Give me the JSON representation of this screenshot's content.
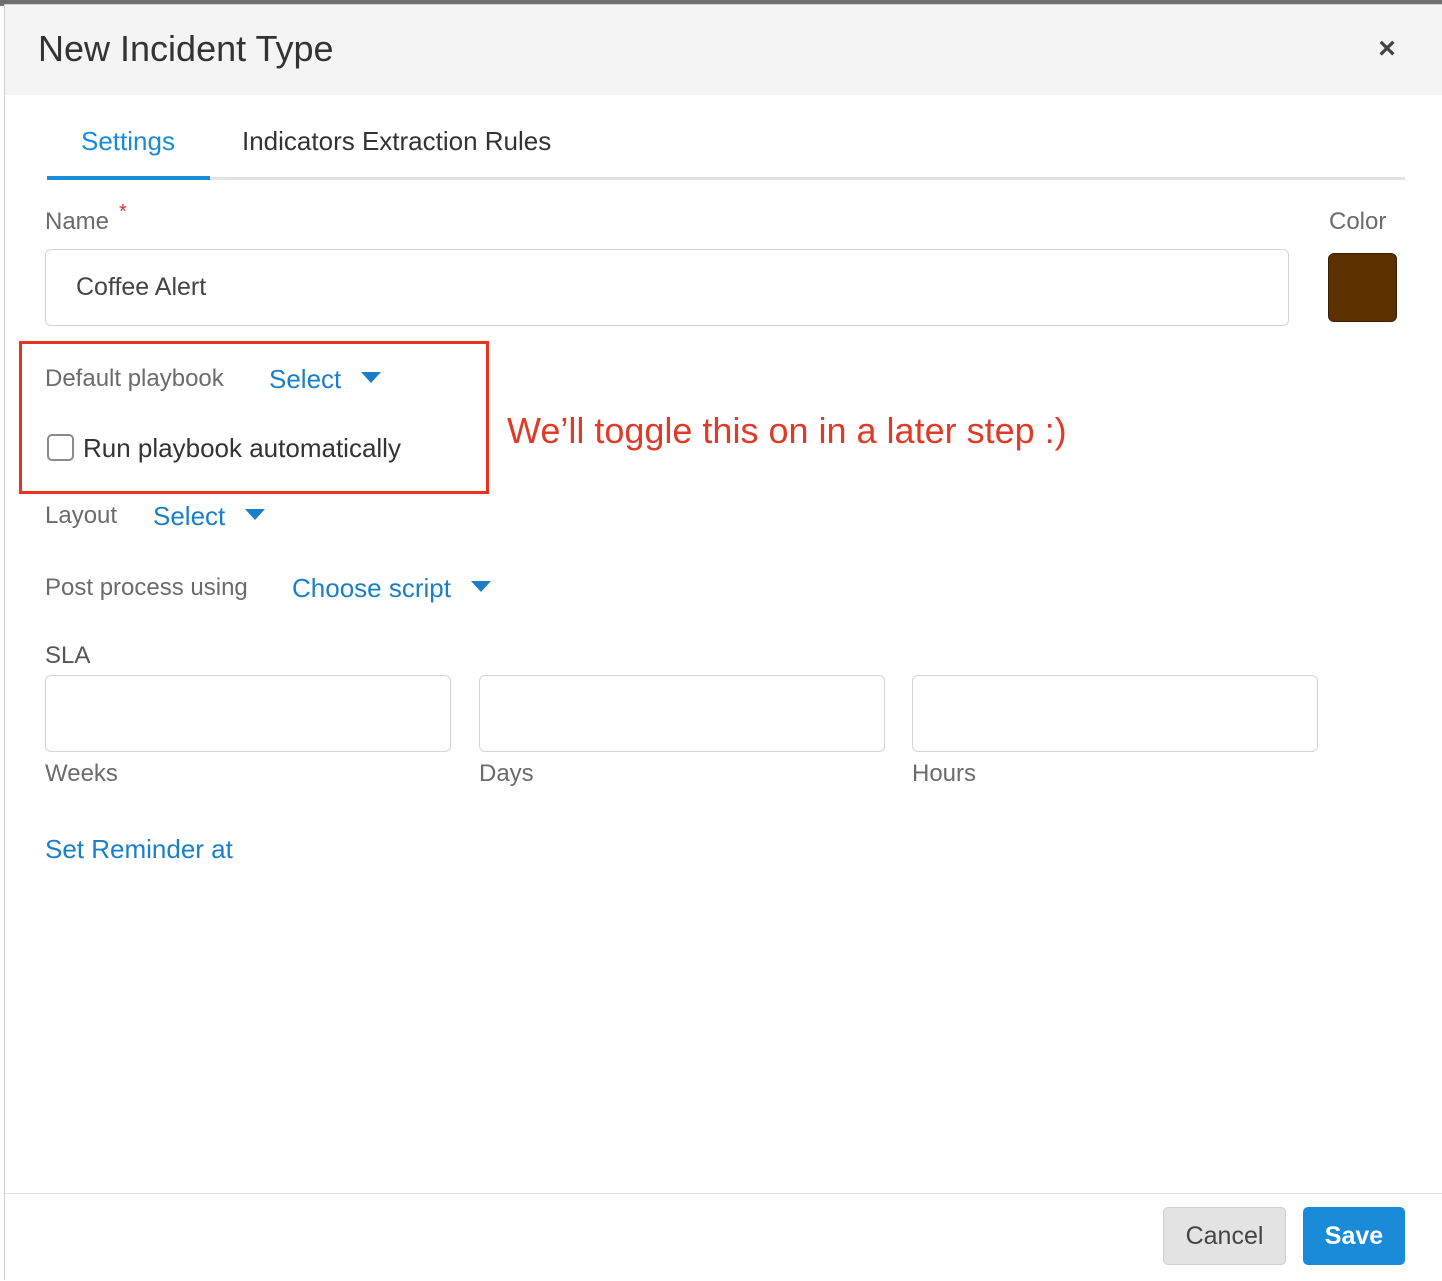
{
  "dialog": {
    "title": "New Incident Type",
    "close_label": "×"
  },
  "tabs": [
    {
      "label": "Settings",
      "active": true
    },
    {
      "label": "Indicators Extraction Rules",
      "active": false
    }
  ],
  "form": {
    "name_label": "Name",
    "required_mark": "*",
    "name_value": "Coffee Alert",
    "color_label": "Color",
    "color_value": "#5c3000",
    "default_playbook_label": "Default playbook",
    "default_playbook_value": "Select",
    "run_playbook_label": "Run playbook automatically",
    "run_playbook_checked": false,
    "layout_label": "Layout",
    "layout_value": "Select",
    "post_process_label": "Post process using",
    "post_process_value": "Choose script",
    "sla_label": "SLA",
    "sla_fields": [
      {
        "label": "Weeks",
        "value": ""
      },
      {
        "label": "Days",
        "value": ""
      },
      {
        "label": "Hours",
        "value": ""
      }
    ],
    "reminder_link": "Set Reminder at"
  },
  "annotation": {
    "text": "We’ll toggle this on in a later step :)",
    "color": "#e03a28"
  },
  "footer": {
    "cancel_label": "Cancel",
    "save_label": "Save"
  },
  "theme": {
    "accent": "#1a8bd8",
    "highlight_border": "#e8321e"
  }
}
